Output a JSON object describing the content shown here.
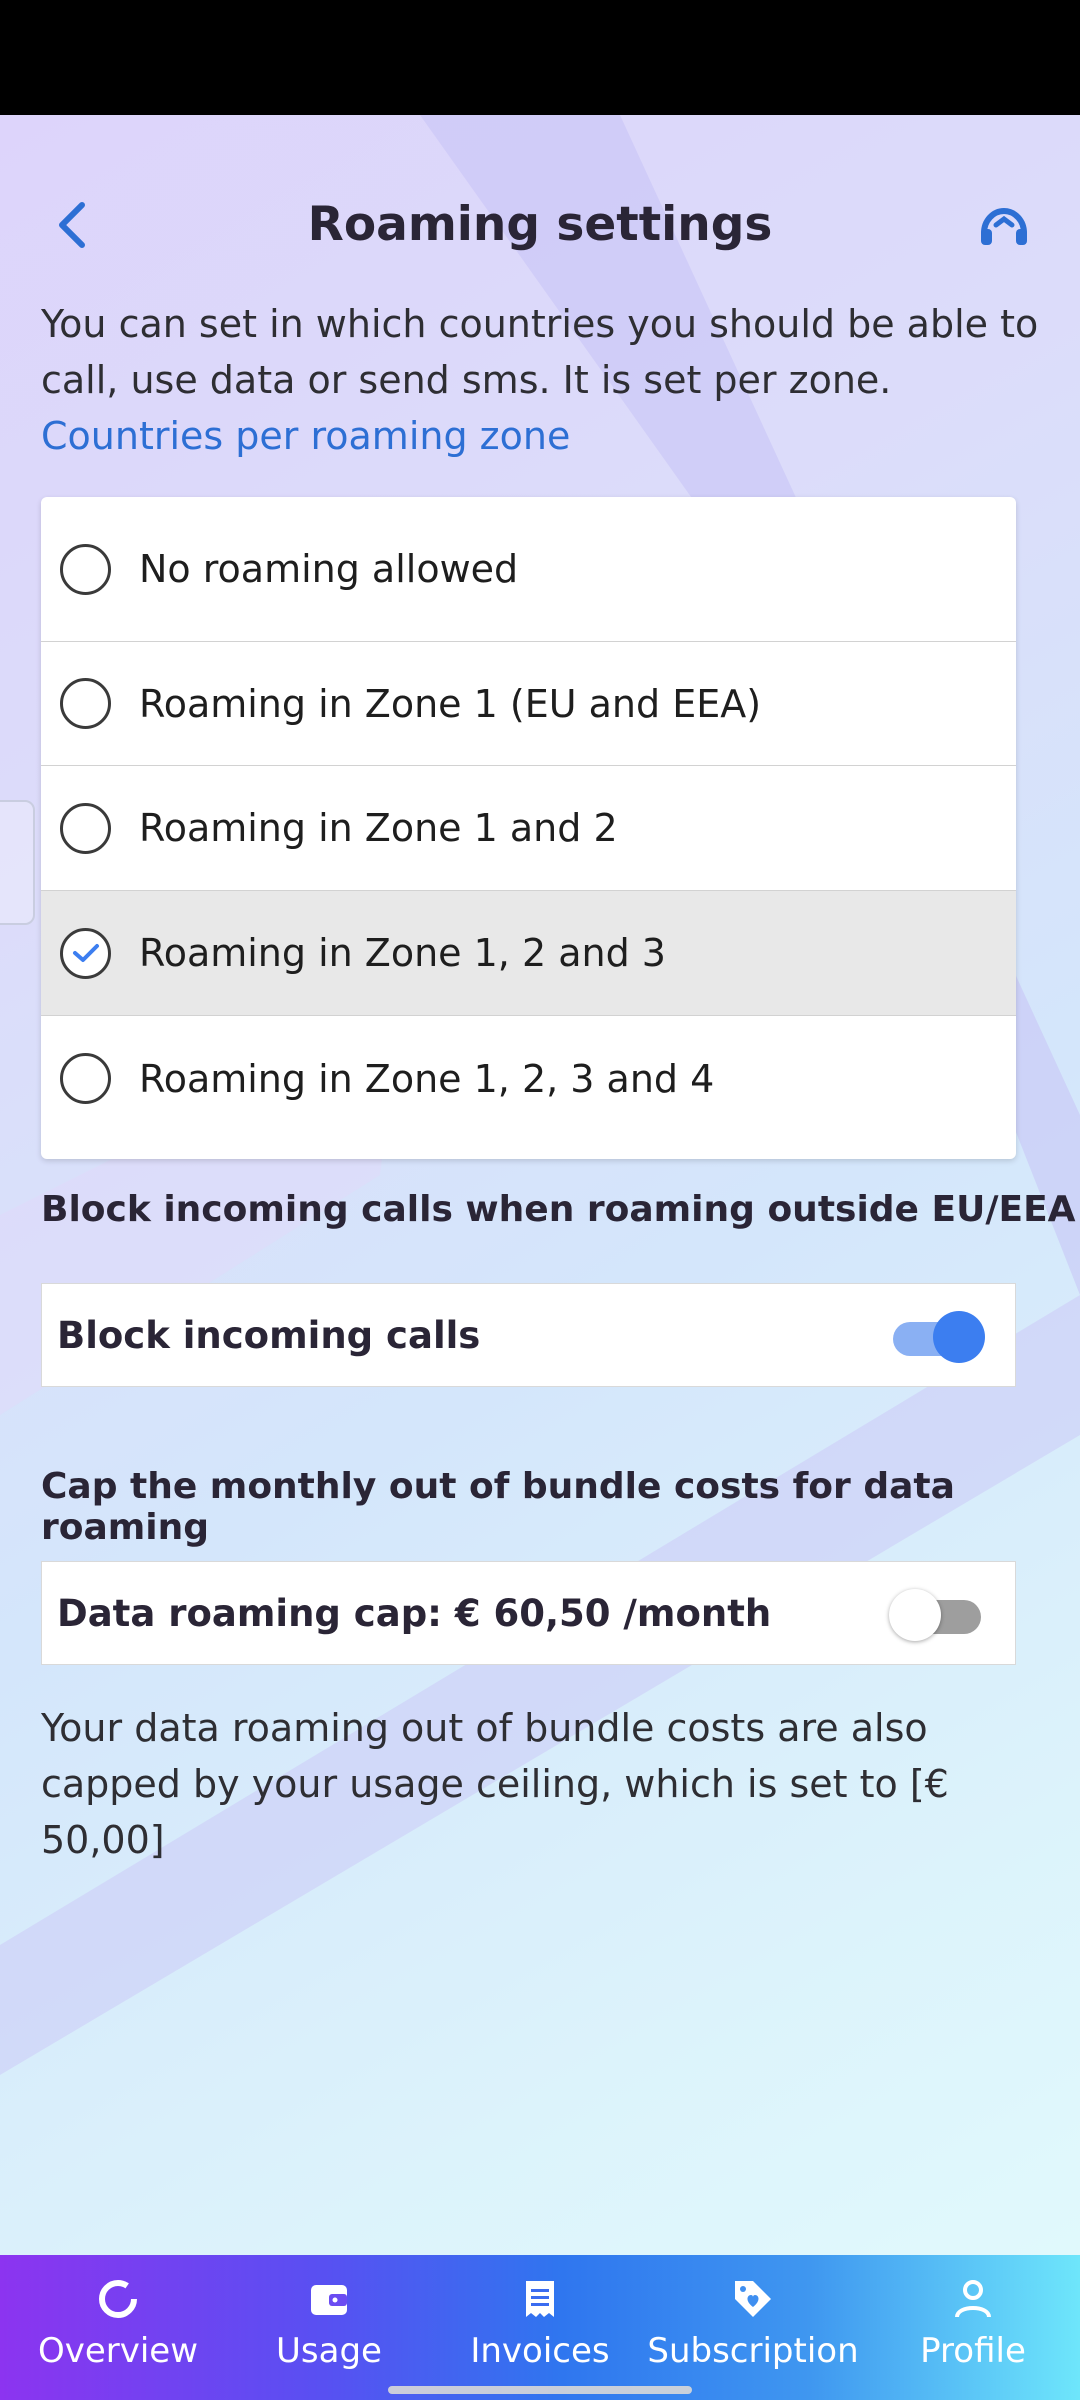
{
  "header": {
    "title": "Roaming settings",
    "back_icon": "chevron-left-icon",
    "support_icon": "headset-icon"
  },
  "intro": {
    "text": "You can set in which countries you should be able to call, use data or send sms. It is set per zone.",
    "link": "Countries per roaming zone"
  },
  "roaming_options": [
    {
      "label": "No roaming allowed",
      "selected": false
    },
    {
      "label": "Roaming in Zone 1 (EU and EEA)",
      "selected": false
    },
    {
      "label": "Roaming in Zone 1 and 2",
      "selected": false
    },
    {
      "label": "Roaming in Zone 1, 2 and 3",
      "selected": true
    },
    {
      "label": "Roaming in Zone 1, 2, 3 and 4",
      "selected": false
    }
  ],
  "block_calls": {
    "section_title": "Block incoming calls when roaming outside EU/EEA",
    "label": "Block incoming calls",
    "enabled": true
  },
  "data_cap": {
    "section_title": "Cap the monthly out of bundle costs for data roaming",
    "label": "Data roaming cap:  € 60,50 /month",
    "enabled": false
  },
  "note": "Your data roaming out of bundle costs are also capped by your usage ceiling, which is set to [€ 50,00]",
  "bottom_nav": [
    {
      "label": "Overview",
      "icon": "donut-chart-icon"
    },
    {
      "label": "Usage",
      "icon": "wallet-icon"
    },
    {
      "label": "Invoices",
      "icon": "receipt-icon"
    },
    {
      "label": "Subscription",
      "icon": "tag-heart-icon"
    },
    {
      "label": "Profile",
      "icon": "person-icon"
    }
  ],
  "colors": {
    "accent_blue": "#2d6fd4",
    "toggle_on": "#3c7ef0",
    "title_text": "#2a2536"
  }
}
